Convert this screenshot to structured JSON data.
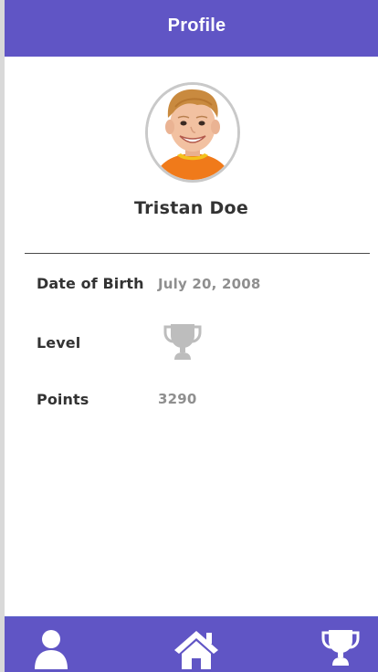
{
  "header": {
    "title": "Profile"
  },
  "profile": {
    "name": "Tristan Doe",
    "fields": {
      "dob_label": "Date of Birth",
      "dob_value": "July 20, 2008",
      "level_label": "Level",
      "level_icon": "trophy-icon",
      "points_label": "Points",
      "points_value": "3290"
    }
  },
  "bottom_nav": {
    "items": [
      {
        "name": "profile",
        "icon": "user-icon"
      },
      {
        "name": "home",
        "icon": "home-icon"
      },
      {
        "name": "achievements",
        "icon": "trophy-icon"
      }
    ]
  },
  "colors": {
    "brand": "#6055c5",
    "text_dark": "#333333",
    "text_muted": "#8f8f8f",
    "level_icon": "#bdbdbd",
    "nav_icon": "#ffffff"
  }
}
